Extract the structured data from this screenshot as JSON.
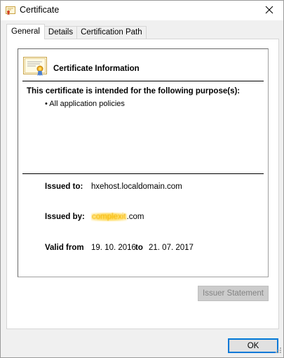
{
  "window": {
    "title": "Certificate",
    "close_glyph": "✕"
  },
  "tabs": [
    {
      "label": "General",
      "active": true
    },
    {
      "label": "Details",
      "active": false
    },
    {
      "label": "Certification Path",
      "active": false
    }
  ],
  "info": {
    "title": "Certificate Information",
    "purpose_heading": "This certificate is intended for the following purpose(s):",
    "purposes": [
      "• All application policies"
    ],
    "issued_to_label": "Issued to:",
    "issued_to_value": "hxehost.localdomain.com",
    "issued_by_label": "Issued by:",
    "issued_by_redacted": "complexit",
    "issued_by_suffix": ".com",
    "valid_from_label": "Valid from",
    "valid_from_value": "19. 10. 2016",
    "to_label": "to",
    "valid_to_value": "21. 07. 2017"
  },
  "buttons": {
    "issuer_statement": "Issuer Statement",
    "ok": "OK"
  },
  "colors": {
    "accent": "#0078d7",
    "redaction": "#ffd84a"
  },
  "icons": {
    "title": "certificate-icon",
    "info": "certificate-ribbon-icon",
    "close": "close-icon"
  }
}
